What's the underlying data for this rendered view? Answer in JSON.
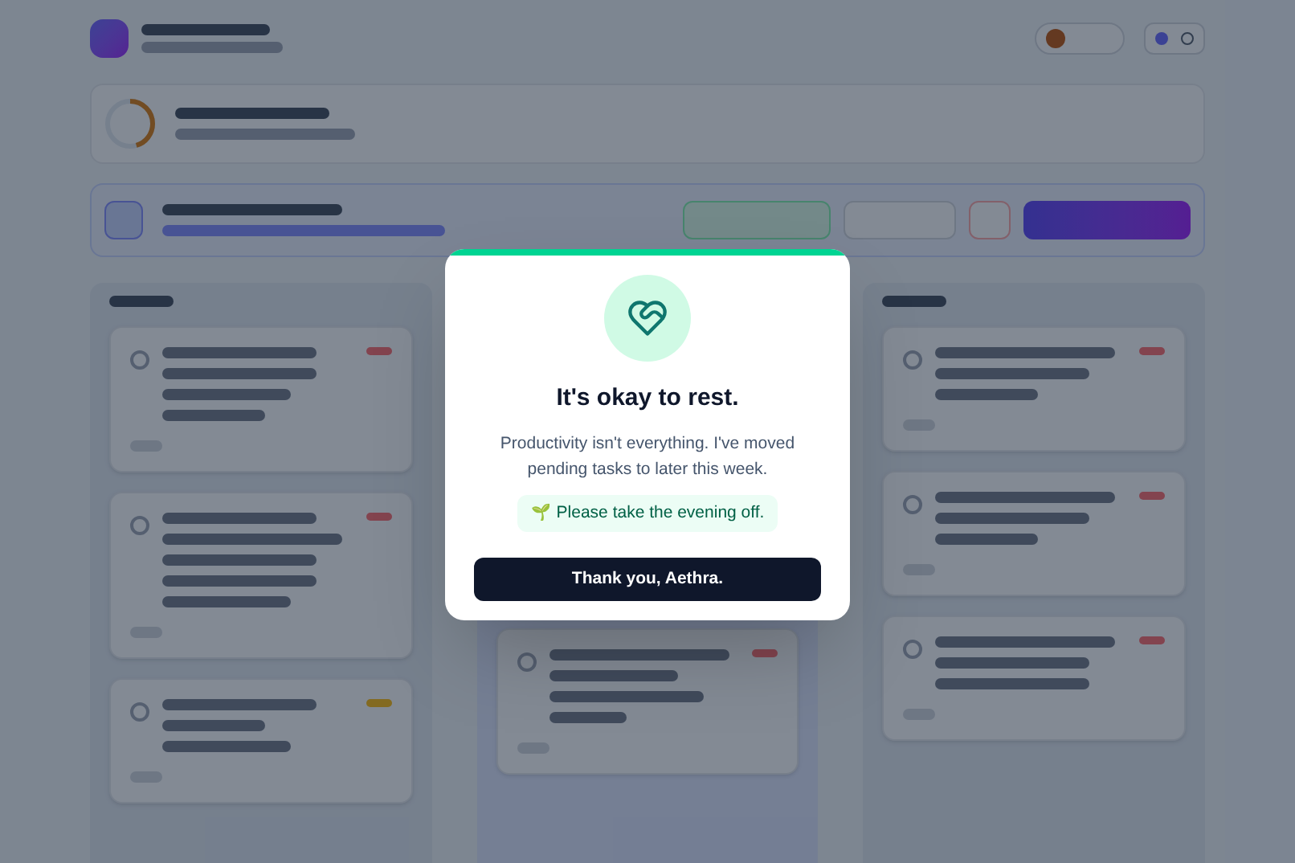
{
  "dialog": {
    "title": "It's okay to rest.",
    "message": "Productivity isn't everything. I've moved pending tasks to later this week.",
    "note_icon": "🌱",
    "note": "Please take the evening off.",
    "button": "Thank you, Aethra."
  }
}
